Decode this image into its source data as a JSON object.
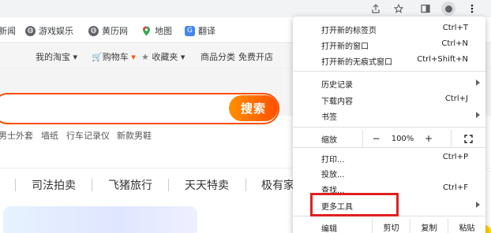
{
  "toolbar": {
    "share_icon": "share-icon",
    "star_icon": "star-icon",
    "sidepanel_icon": "side-panel-icon",
    "profile_icon": "profile-icon",
    "menu_icon": "kebab-menu-icon"
  },
  "bookmarks": [
    {
      "label": "新闻",
      "icon": "news-icon",
      "color": "#3c4043"
    },
    {
      "label": "游戏娱乐",
      "icon": "globe-icon",
      "color": "#3c4043"
    },
    {
      "label": "黄历网",
      "icon": "globe-icon",
      "color": "#3c4043"
    },
    {
      "label": "地图",
      "icon": "maps-icon",
      "color": "#34a853"
    },
    {
      "label": "翻译",
      "icon": "translate-icon",
      "color": "#4285f4"
    }
  ],
  "site_nav": {
    "my_taobao": "我的淘宝",
    "cart": "购物车",
    "favorites": "收藏夹",
    "categories": "商品分类",
    "open_store": "免费开店"
  },
  "search": {
    "button_label": "搜索",
    "hot_terms": [
      "男士外套",
      "墙纸",
      "行车记录仪",
      "新款男鞋"
    ]
  },
  "categories": [
    "司法拍卖",
    "飞猪旅行",
    "天天特卖",
    "极有家"
  ],
  "menu": {
    "new_tab": {
      "label": "打开新的标签页",
      "shortcut": "Ctrl+T"
    },
    "new_window": {
      "label": "打开新的窗口",
      "shortcut": "Ctrl+N"
    },
    "incognito": {
      "label": "打开新的无痕式窗口",
      "shortcut": "Ctrl+Shift+N"
    },
    "history": {
      "label": "历史记录"
    },
    "downloads": {
      "label": "下载内容",
      "shortcut": "Ctrl+J"
    },
    "bookmarks": {
      "label": "书签"
    },
    "zoom": {
      "label": "缩放",
      "minus": "−",
      "value": "100%",
      "plus": "+"
    },
    "print": {
      "label": "打印...",
      "shortcut": "Ctrl+P"
    },
    "cast": {
      "label": "投放..."
    },
    "find": {
      "label": "查找...",
      "shortcut": "Ctrl+F"
    },
    "more_tools": {
      "label": "更多工具"
    },
    "edit": {
      "label": "编辑",
      "cut": "剪切",
      "copy": "复制",
      "paste": "粘贴"
    }
  },
  "colors": {
    "brand_orange": "#ff5000",
    "highlight_red": "#e02020"
  }
}
